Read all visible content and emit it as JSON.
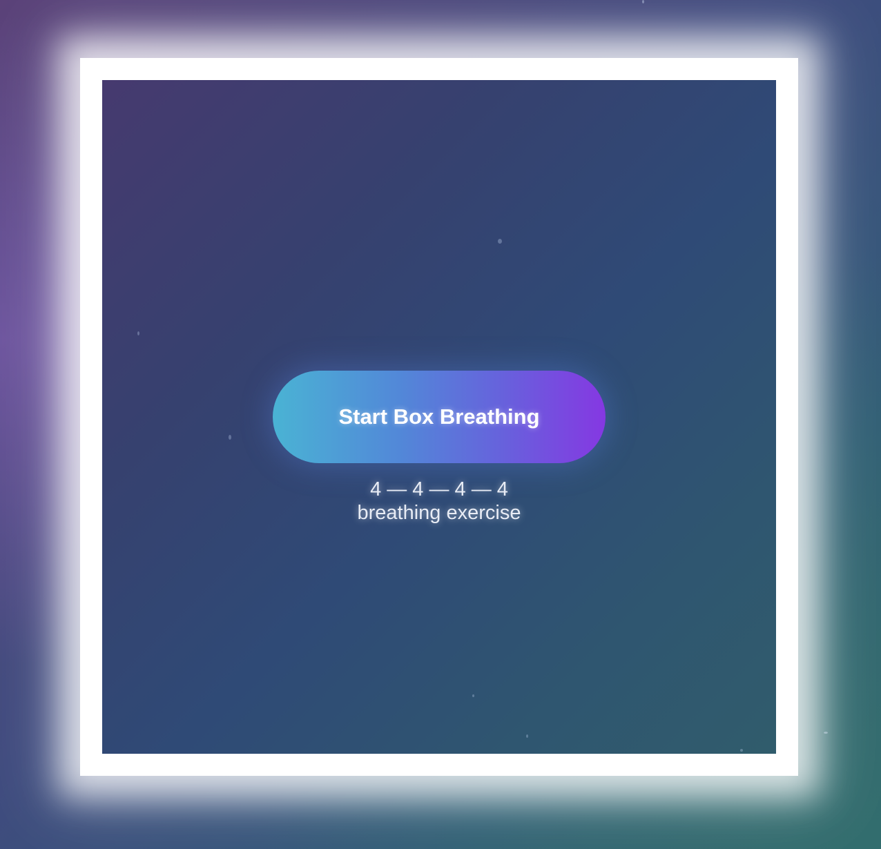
{
  "breathing": {
    "start_button_label": "Start Box Breathing",
    "pattern": "4 — 4 — 4 — 4",
    "subtitle": "breathing exercise"
  },
  "colors": {
    "button_gradient_start": "#4ab3d4",
    "button_gradient_end": "#8538e2",
    "frame_border": "#ffffff"
  }
}
